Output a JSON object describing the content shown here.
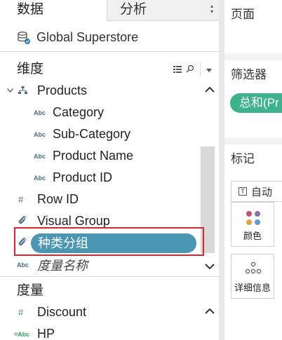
{
  "tabs": {
    "data_label": "数据",
    "analytics_label": "分析"
  },
  "datasource": {
    "name": "Global Superstore"
  },
  "dimensions": {
    "header": "维度",
    "group": {
      "label": "Products",
      "type": "hierarchy"
    },
    "children": [
      {
        "label": "Category",
        "type_label": "Abc"
      },
      {
        "label": "Sub-Category",
        "type_label": "Abc"
      },
      {
        "label": "Product Name",
        "type_label": "Abc"
      },
      {
        "label": "Product ID",
        "type_label": "Abc"
      }
    ],
    "row_id": {
      "label": "Row ID",
      "type_label": "#"
    },
    "visual_group": {
      "label": "Visual Group"
    },
    "selected_group": {
      "label": "种类分组"
    },
    "measure_names": {
      "label": "度量名称",
      "type_label": "Abc"
    }
  },
  "measures": {
    "header": "度量",
    "items": [
      {
        "label": "Discount",
        "type_label": "#"
      },
      {
        "label": "HP",
        "type_label": "=Abc"
      }
    ]
  },
  "pages_card": {
    "title": "页面"
  },
  "filters_card": {
    "title": "筛选器",
    "pill": "总和(Pr"
  },
  "marks_card": {
    "title": "标记",
    "mark_type": "自动",
    "color_label": "颜色",
    "detail_label": "详细信息"
  },
  "colors": {
    "selected_pill": "#4a96b3",
    "filter_pill": "#3cb38d",
    "highlight_box": "#d9272e"
  }
}
